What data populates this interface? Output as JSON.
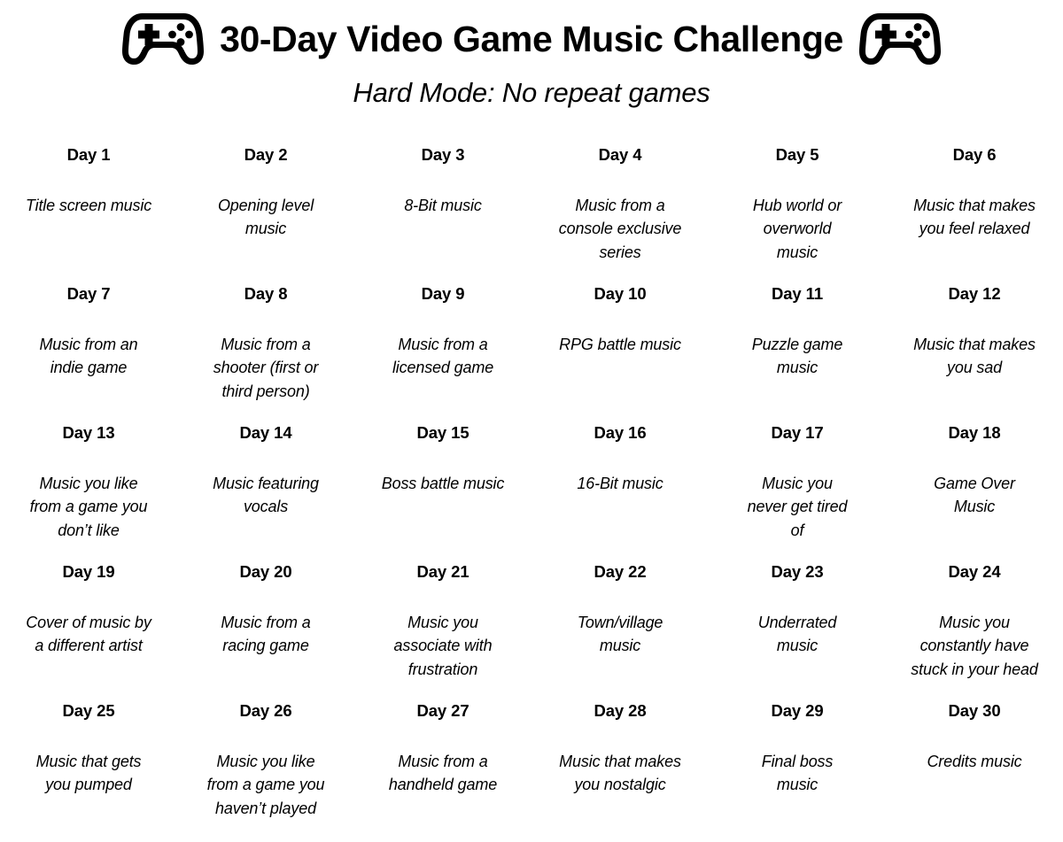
{
  "header": {
    "title": "30-Day Video Game Music Challenge",
    "subtitle": "Hard Mode: No repeat games",
    "left_icon": "game-controller-icon",
    "right_icon": "game-controller-icon"
  },
  "colors": {
    "background": "#ffffff",
    "text": "#000000"
  },
  "grid": {
    "columns": 6,
    "rows": 5,
    "cells": [
      {
        "day": "Day 1",
        "prompt": "Title screen music"
      },
      {
        "day": "Day 2",
        "prompt": "Opening level\nmusic"
      },
      {
        "day": "Day 3",
        "prompt": "8-Bit music"
      },
      {
        "day": "Day 4",
        "prompt": "Music from a\nconsole exclusive\nseries"
      },
      {
        "day": "Day 5",
        "prompt": "Hub world or\noverworld\nmusic"
      },
      {
        "day": "Day 6",
        "prompt": "Music that makes\nyou feel relaxed"
      },
      {
        "day": "Day 7",
        "prompt": "Music from an\nindie game"
      },
      {
        "day": "Day 8",
        "prompt": "Music from a\nshooter (first or\nthird person)"
      },
      {
        "day": "Day 9",
        "prompt": "Music from a\nlicensed game"
      },
      {
        "day": "Day 10",
        "prompt": "RPG battle music"
      },
      {
        "day": "Day 11",
        "prompt": "Puzzle game\nmusic"
      },
      {
        "day": "Day 12",
        "prompt": "Music that makes\nyou sad"
      },
      {
        "day": "Day 13",
        "prompt": "Music you like\nfrom a game you\ndon’t like"
      },
      {
        "day": "Day 14",
        "prompt": "Music featuring\nvocals"
      },
      {
        "day": "Day 15",
        "prompt": "Boss battle music"
      },
      {
        "day": "Day 16",
        "prompt": "16-Bit music"
      },
      {
        "day": "Day 17",
        "prompt": "Music you\nnever get tired\nof"
      },
      {
        "day": "Day 18",
        "prompt": "Game Over\nMusic"
      },
      {
        "day": "Day 19",
        "prompt": "Cover of music by\na different artist"
      },
      {
        "day": "Day 20",
        "prompt": "Music from a\nracing game"
      },
      {
        "day": "Day 21",
        "prompt": "Music you\nassociate with\nfrustration"
      },
      {
        "day": "Day 22",
        "prompt": "Town/village\nmusic"
      },
      {
        "day": "Day 23",
        "prompt": "Underrated\nmusic"
      },
      {
        "day": "Day 24",
        "prompt": "Music you\nconstantly have\nstuck in your head"
      },
      {
        "day": "Day 25",
        "prompt": "Music that gets\nyou pumped"
      },
      {
        "day": "Day 26",
        "prompt": "Music you like\nfrom a game you\nhaven’t played"
      },
      {
        "day": "Day 27",
        "prompt": "Music from a\nhandheld game"
      },
      {
        "day": "Day 28",
        "prompt": "Music that makes\nyou nostalgic"
      },
      {
        "day": "Day 29",
        "prompt": "Final boss\nmusic"
      },
      {
        "day": "Day 30",
        "prompt": "Credits music"
      }
    ]
  }
}
